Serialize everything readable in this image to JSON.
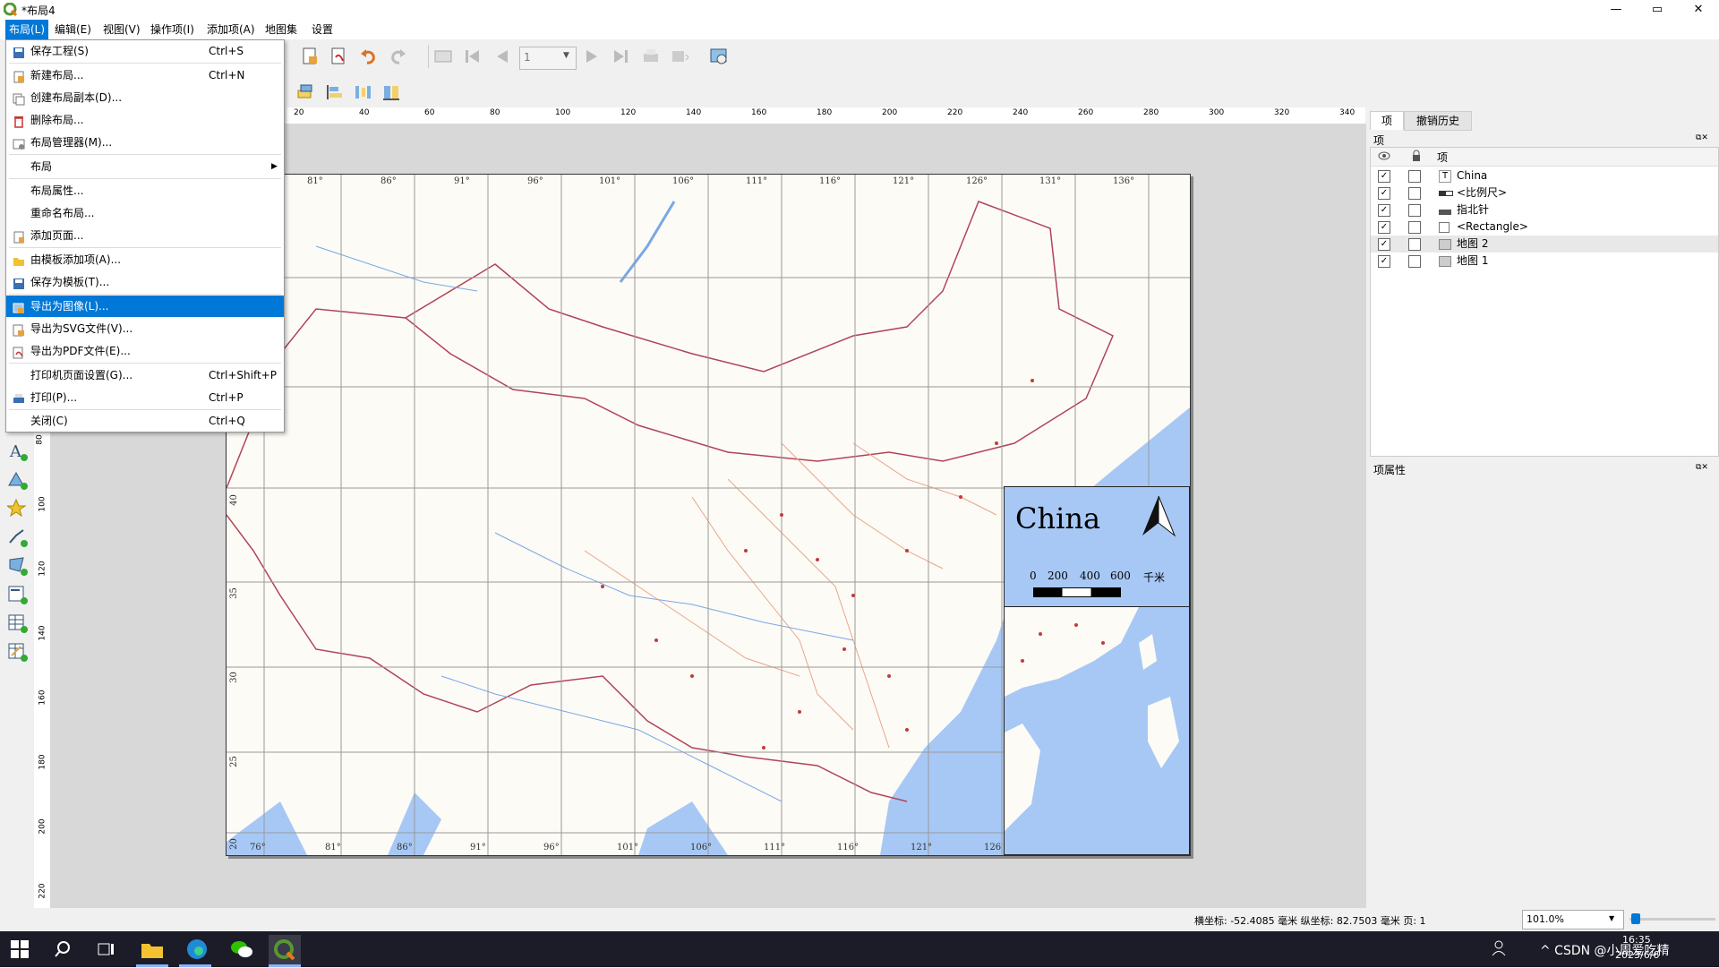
{
  "window": {
    "title": "*布局4",
    "controls": [
      "—",
      "▭",
      "✕"
    ]
  },
  "menubar": {
    "items": [
      {
        "label": "布局(L)",
        "active": true
      },
      {
        "label": "编辑(E)"
      },
      {
        "label": "视图(V)"
      },
      {
        "label": "操作项(I)"
      },
      {
        "label": "添加项(A)"
      },
      {
        "label": "地图集"
      },
      {
        "label": "设置"
      }
    ]
  },
  "layout_menu": {
    "items": [
      {
        "label": "保存工程(S)",
        "shortcut": "Ctrl+S",
        "icon": "save-icon"
      },
      {
        "label": "新建布局...",
        "shortcut": "Ctrl+N",
        "icon": "new-layout-icon"
      },
      {
        "label": "创建布局副本(D)...",
        "shortcut": "",
        "icon": "duplicate-icon"
      },
      {
        "label": "删除布局...",
        "shortcut": "",
        "icon": "delete-icon"
      },
      {
        "label": "布局管理器(M)...",
        "shortcut": "",
        "icon": "layout-manager-icon"
      },
      {
        "label": "布局",
        "shortcut": "",
        "icon": "",
        "submenu": true
      },
      {
        "label": "布局属性...",
        "shortcut": "",
        "icon": ""
      },
      {
        "label": "重命名布局...",
        "shortcut": "",
        "icon": ""
      },
      {
        "label": "添加页面...",
        "shortcut": "",
        "icon": "add-page-icon"
      },
      {
        "label": "由模板添加项(A)...",
        "shortcut": "",
        "icon": "folder-icon"
      },
      {
        "label": "保存为模板(T)...",
        "shortcut": "",
        "icon": "save-template-icon"
      },
      {
        "label": "导出为图像(L)...",
        "shortcut": "",
        "icon": "export-image-icon",
        "selected": true
      },
      {
        "label": "导出为SVG文件(V)...",
        "shortcut": "",
        "icon": "export-svg-icon"
      },
      {
        "label": "导出为PDF文件(E)...",
        "shortcut": "",
        "icon": "export-pdf-icon"
      },
      {
        "label": "打印机页面设置(G)...",
        "shortcut": "Ctrl+Shift+P",
        "icon": ""
      },
      {
        "label": "打印(P)...",
        "shortcut": "Ctrl+P",
        "icon": "print-icon"
      },
      {
        "label": "关闭(C)",
        "shortcut": "Ctrl+Q",
        "icon": ""
      }
    ]
  },
  "toolbar": {
    "page_value": "1"
  },
  "hruler": {
    "ticks": [
      "20",
      "40",
      "60",
      "80",
      "100",
      "120",
      "140",
      "160",
      "180",
      "200",
      "220",
      "240",
      "260",
      "280",
      "300",
      "320",
      "340"
    ]
  },
  "vruler": {
    "ticks": [
      "80",
      "100",
      "120",
      "140",
      "160",
      "180",
      "200",
      "220"
    ]
  },
  "map": {
    "top_longitudes": [
      "81°",
      "86°",
      "91°",
      "96°",
      "101°",
      "106°",
      "111°",
      "116°",
      "121°",
      "126°",
      "131°",
      "136°"
    ],
    "bottom_longitudes": [
      "76°",
      "81°",
      "86°",
      "91°",
      "96°",
      "101°",
      "106°",
      "111°",
      "116°",
      "121°",
      "126"
    ],
    "left_latitudes": [
      "40",
      "35",
      "30",
      "25",
      "20"
    ],
    "legend_title": "China",
    "scalebar_labels": [
      "0",
      "200",
      "400",
      "600",
      "千米"
    ],
    "colors": {
      "sea": "#a7c8f5",
      "land": "#fdfbf6",
      "border": "#b0435a",
      "road": "#e8a58a"
    }
  },
  "right_panel": {
    "tabs": [
      "项",
      "撤销历史"
    ],
    "items_section_title": "项",
    "header_label": "项",
    "layers": [
      {
        "label": "China",
        "checked": true,
        "icon": "text-icon"
      },
      {
        "label": "<比例尺>",
        "checked": true,
        "icon": "scalebar-icon"
      },
      {
        "label": "指北针",
        "checked": true,
        "icon": "north-arrow-icon"
      },
      {
        "label": "<Rectangle>",
        "checked": true,
        "icon": "rectangle-icon"
      },
      {
        "label": "地图 2",
        "checked": true,
        "icon": "map-icon",
        "highlighted": true
      },
      {
        "label": "地图 1",
        "checked": true,
        "icon": "map-icon"
      }
    ],
    "properties_title": "项属性"
  },
  "statusbar": {
    "coords": "横坐标: -52.4085 毫米 纵坐标: 82.7503 毫米 页: 1",
    "zoom": "101.0%"
  },
  "taskbar": {
    "time": "16:35",
    "date": "2023/6/6",
    "tray_text": "^ CSDN @小周爱吃精",
    "network_icon": "person-icon"
  }
}
